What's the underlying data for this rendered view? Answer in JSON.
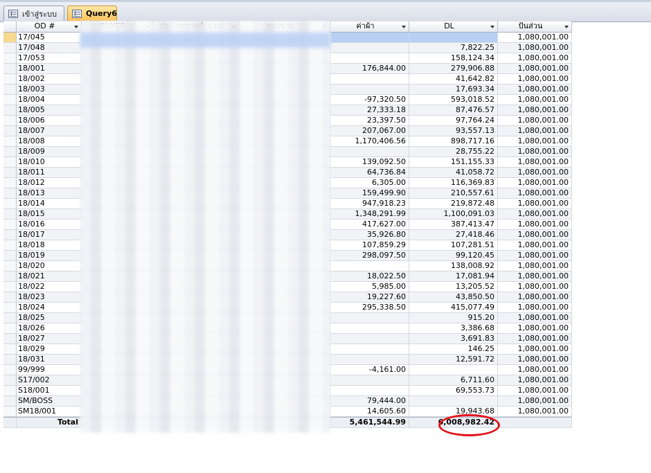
{
  "tabs": [
    {
      "label": "เข้าสู่ระบบ",
      "active": false
    },
    {
      "label": "Query6",
      "active": true
    }
  ],
  "columns": [
    {
      "key": "od",
      "label": "OD #"
    },
    {
      "key": "buyer",
      "label": "BUYER"
    },
    {
      "key": "type",
      "label": "ประเภทการคำนวณ"
    },
    {
      "key": "sales",
      "label": "ยอดขาย"
    },
    {
      "key": "kp",
      "label": "ค่าผ้า"
    },
    {
      "key": "dl",
      "label": "DL"
    },
    {
      "key": "share",
      "label": "ปันส่วน"
    }
  ],
  "rows": [
    {
      "od": "17/045",
      "kp": "",
      "dl": "",
      "share": "1,080,001.00"
    },
    {
      "od": "17/048",
      "kp": "",
      "dl": "7,822.25",
      "share": "1,080,001.00"
    },
    {
      "od": "17/053",
      "kp": "",
      "dl": "158,124.34",
      "share": "1,080,001.00"
    },
    {
      "od": "18/001",
      "kp": "176,844.00",
      "dl": "279,906.88",
      "share": "1,080,001.00"
    },
    {
      "od": "18/002",
      "kp": "",
      "dl": "41,642.82",
      "share": "1,080,001.00"
    },
    {
      "od": "18/003",
      "kp": "",
      "dl": "17,693.34",
      "share": "1,080,001.00"
    },
    {
      "od": "18/004",
      "kp": "-97,320.50",
      "dl": "593,018.52",
      "share": "1,080,001.00"
    },
    {
      "od": "18/005",
      "kp": "27,333.18",
      "dl": "87,476.57",
      "share": "1,080,001.00"
    },
    {
      "od": "18/006",
      "kp": "23,397.50",
      "dl": "97,764.24",
      "share": "1,080,001.00"
    },
    {
      "od": "18/007",
      "kp": "207,067.00",
      "dl": "93,557.13",
      "share": "1,080,001.00"
    },
    {
      "od": "18/008",
      "kp": "1,170,406.56",
      "dl": "898,717.16",
      "share": "1,080,001.00"
    },
    {
      "od": "18/009",
      "kp": "",
      "dl": "28,755.22",
      "share": "1,080,001.00"
    },
    {
      "od": "18/010",
      "kp": "139,092.50",
      "dl": "151,155.33",
      "share": "1,080,001.00"
    },
    {
      "od": "18/011",
      "kp": "64,736.84",
      "dl": "41,058.72",
      "share": "1,080,001.00"
    },
    {
      "od": "18/012",
      "kp": "6,305.00",
      "dl": "116,369.83",
      "share": "1,080,001.00"
    },
    {
      "od": "18/013",
      "kp": "159,499.90",
      "dl": "210,557.61",
      "share": "1,080,001.00"
    },
    {
      "od": "18/014",
      "kp": "947,918.23",
      "dl": "219,872.48",
      "share": "1,080,001.00"
    },
    {
      "od": "18/015",
      "kp": "1,348,291.99",
      "dl": "1,100,091.03",
      "share": "1,080,001.00"
    },
    {
      "od": "18/016",
      "kp": "417,627.00",
      "dl": "387,413.47",
      "share": "1,080,001.00"
    },
    {
      "od": "18/017",
      "kp": "35,926.80",
      "dl": "27,418.46",
      "share": "1,080,001.00"
    },
    {
      "od": "18/018",
      "kp": "107,859.29",
      "dl": "107,281.51",
      "share": "1,080,001.00"
    },
    {
      "od": "18/019",
      "kp": "298,097.50",
      "dl": "99,120.45",
      "share": "1,080,001.00"
    },
    {
      "od": "18/020",
      "kp": "",
      "dl": "138,008.92",
      "share": "1,080,001.00"
    },
    {
      "od": "18/021",
      "kp": "18,022.50",
      "dl": "17,081.94",
      "share": "1,080,001.00"
    },
    {
      "od": "18/022",
      "kp": "5,985.00",
      "dl": "13,205.52",
      "share": "1,080,001.00"
    },
    {
      "od": "18/023",
      "kp": "19,227.60",
      "dl": "43,850.50",
      "share": "1,080,001.00"
    },
    {
      "od": "18/024",
      "kp": "295,338.50",
      "dl": "415,077.49",
      "share": "1,080,001.00"
    },
    {
      "od": "18/025",
      "kp": "",
      "dl": "915.20",
      "share": "1,080,001.00"
    },
    {
      "od": "18/026",
      "kp": "",
      "dl": "3,386.68",
      "share": "1,080,001.00"
    },
    {
      "od": "18/027",
      "kp": "",
      "dl": "3,691.83",
      "share": "1,080,001.00"
    },
    {
      "od": "18/029",
      "kp": "",
      "dl": "146.25",
      "share": "1,080,001.00"
    },
    {
      "od": "18/031",
      "kp": "",
      "dl": "12,591.72",
      "share": "1,080,001.00"
    },
    {
      "od": "99/999",
      "kp": "-4,161.00",
      "dl": "",
      "share": "1,080,001.00"
    },
    {
      "od": "S17/002",
      "kp": "",
      "dl": "6,711.60",
      "share": "1,080,001.00"
    },
    {
      "od": "S18/001",
      "kp": "",
      "dl": "69,553.73",
      "share": "1,080,001.00"
    },
    {
      "od": "SM/BOSS",
      "kp": "79,444.00",
      "dl": "",
      "share": "1,080,001.00"
    },
    {
      "od": "SM18/001",
      "kp": "14,605.60",
      "dl": "19,943.68",
      "share": "1,080,001.00"
    }
  ],
  "totals": {
    "label": "Total",
    "kp": "5,461,544.99",
    "dl": "6,008,982.42"
  },
  "highlight_color": "#e0151b"
}
